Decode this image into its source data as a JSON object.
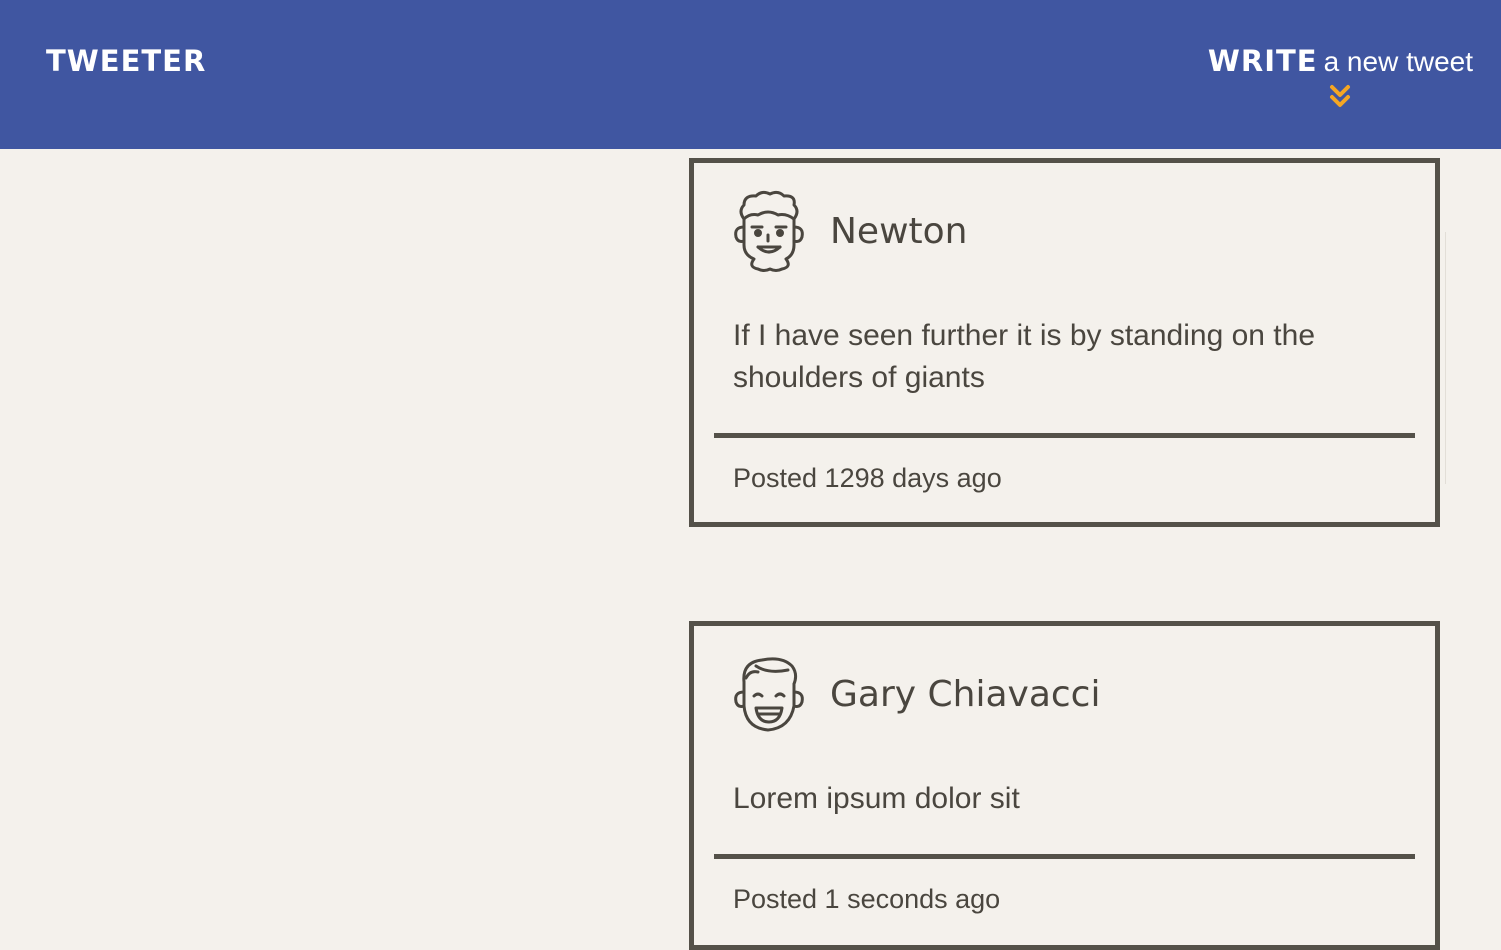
{
  "nav": {
    "brand": "TWEETER",
    "compose_strong": "WRITE",
    "compose_rest": "a new tweet",
    "arrow_icon": "double-chevron-down-icon",
    "background_color": "#4056a1",
    "accent_color": "#f5a623"
  },
  "tweets": [
    {
      "name": "Newton",
      "avatar_icon": "curly-hair-face-icon",
      "content": "If I have seen further it is by standing on the shoulders of giants",
      "footer": "Posted 1298 days ago"
    },
    {
      "name": "Gary Chiavacci",
      "avatar_icon": "smiling-face-icon",
      "content": "Lorem ipsum dolor sit",
      "footer": "Posted 1 seconds ago"
    }
  ]
}
